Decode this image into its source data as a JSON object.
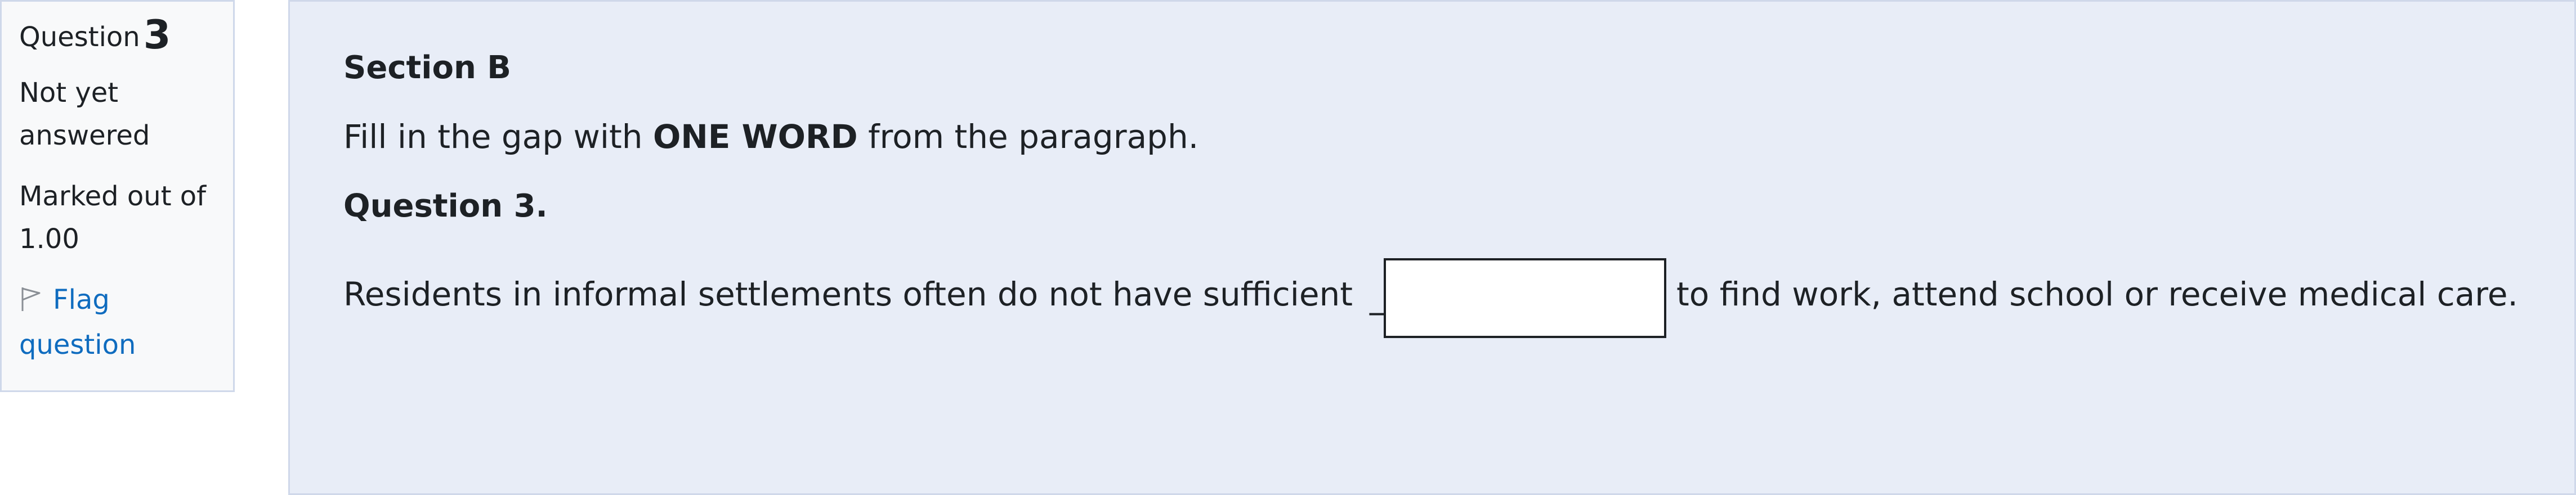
{
  "info": {
    "question_label": "Question",
    "question_number": "3",
    "state": "Not yet answered",
    "grade_line1": "Marked out of",
    "grade_line2": "1.00",
    "flag_label": "Flag question"
  },
  "content": {
    "section_title": "Section B",
    "instruction_prefix": "Fill in the gap with ",
    "instruction_bold": "ONE WORD",
    "instruction_suffix": " from the paragraph.",
    "question_title": "Question 3.",
    "sentence_before": "Residents in informal settlements often do not have sufficient",
    "blank_marker": "_",
    "answer_value": "",
    "sentence_after": "to find work, attend school or receive medical care."
  },
  "icons": {
    "flag": "flag-icon"
  },
  "colors": {
    "link": "#0f6cbf",
    "info_bg": "#f8f9fa",
    "content_bg": "#e8edf7",
    "border": "#cfd8ea"
  }
}
